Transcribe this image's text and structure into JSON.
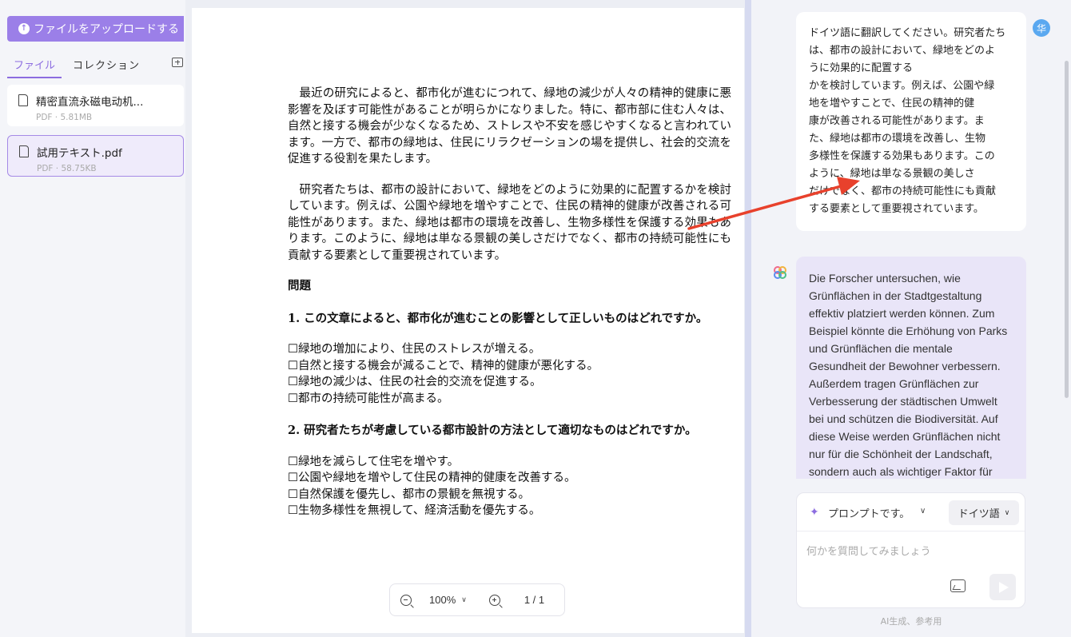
{
  "sidebar": {
    "upload_label": "ファイルをアップロードする",
    "tabs": [
      "ファイル",
      "コレクション"
    ],
    "files": [
      {
        "name": "精密直流永磁电动机...",
        "meta": "PDF · 5.81MB"
      },
      {
        "name": "試用テキスト.pdf",
        "meta": "PDF · 58.75KB"
      }
    ]
  },
  "document": {
    "para1": "最近の研究によると、都市化が進むにつれて、緑地の減少が人々の精神的健康に悪影響を及ぼす可能性があることが明らかになりました。特に、都市部に住む人々は、自然と接する機会が少なくなるため、ストレスや不安を感じやすくなると言われています。一方で、都市の緑地は、住民にリラクゼーションの場を提供し、社会的交流を促進する役割を果たします。",
    "para2": "研究者たちは、都市の設計において、緑地をどのように効果的に配置するかを検討しています。例えば、公園や緑地を増やすことで、住民の精神的健康が改善される可能性があります。また、緑地は都市の環境を改善し、生物多様性を保護する効果もあります。このように、緑地は単なる景観の美しさだけでなく、都市の持続可能性にも貢献する要素として重要視されています。",
    "questions_heading": "問題",
    "q1": "1.  この文章によると、都市化が進むことの影響として正しいものはどれですか。",
    "q1_options": [
      "☐緑地の増加により、住民のストレスが増える。",
      "☐自然と接する機会が減ることで、精神的健康が悪化する。",
      "☐緑地の減少は、住民の社会的交流を促進する。",
      "☐都市の持続可能性が高まる。"
    ],
    "q2": "2.  研究者たちが考慮している都市設計の方法として適切なものはどれですか。",
    "q2_options": [
      "☐緑地を減らして住宅を増やす。",
      "☐公園や緑地を増やして住民の精神的健康を改善する。",
      "☐自然保護を優先し、都市の景観を無視する。",
      "☐生物多様性を無視して、経済活動を優先する。"
    ]
  },
  "zoom": {
    "level": "100%",
    "page": "1 / 1"
  },
  "chat": {
    "user_avatar": "华",
    "user_lines": [
      "ドイツ語に翻訳してください。研究者たち",
      "は、都市の設計において、緑地をどのよ",
      "うに効果的に配置する",
      "かを検討しています。例えば、公園や緑",
      "地を増やすことで、住民の精神的健",
      "康が改善される可能性があります。ま",
      "た、緑地は都市の環境を改善し、生物",
      "多様性を保護する効果もあります。この",
      "ように、緑地は単なる景観の美しさ",
      "だけでなく、都市の持続可能性にも貢献",
      "する要素として重要視されています。"
    ],
    "ai_lines": [
      "Die Forscher untersuchen, wie",
      "Grünflächen in der Stadtgestaltung",
      "effektiv platziert werden können. Zum",
      "Beispiel könnte die Erhöhung von Parks",
      "und Grünflächen die mentale",
      "Gesundheit der Bewohner verbessern.",
      "Außerdem tragen Grünflächen zur",
      "Verbesserung der städtischen Umwelt",
      "bei und schützen die Biodiversität. Auf",
      "diese Weise werden Grünflächen nicht",
      "nur für die Schönheit der Landschaft,",
      "sondern auch als wichtiger Faktor für"
    ],
    "prompt_label": "プロンプトです。",
    "language": "ドイツ語",
    "input_placeholder": "何かを質問してみましょう",
    "footer": "AI生成、参考用"
  },
  "colors": {
    "accent": "#9b7fe8",
    "arrow": "#e8412c"
  }
}
